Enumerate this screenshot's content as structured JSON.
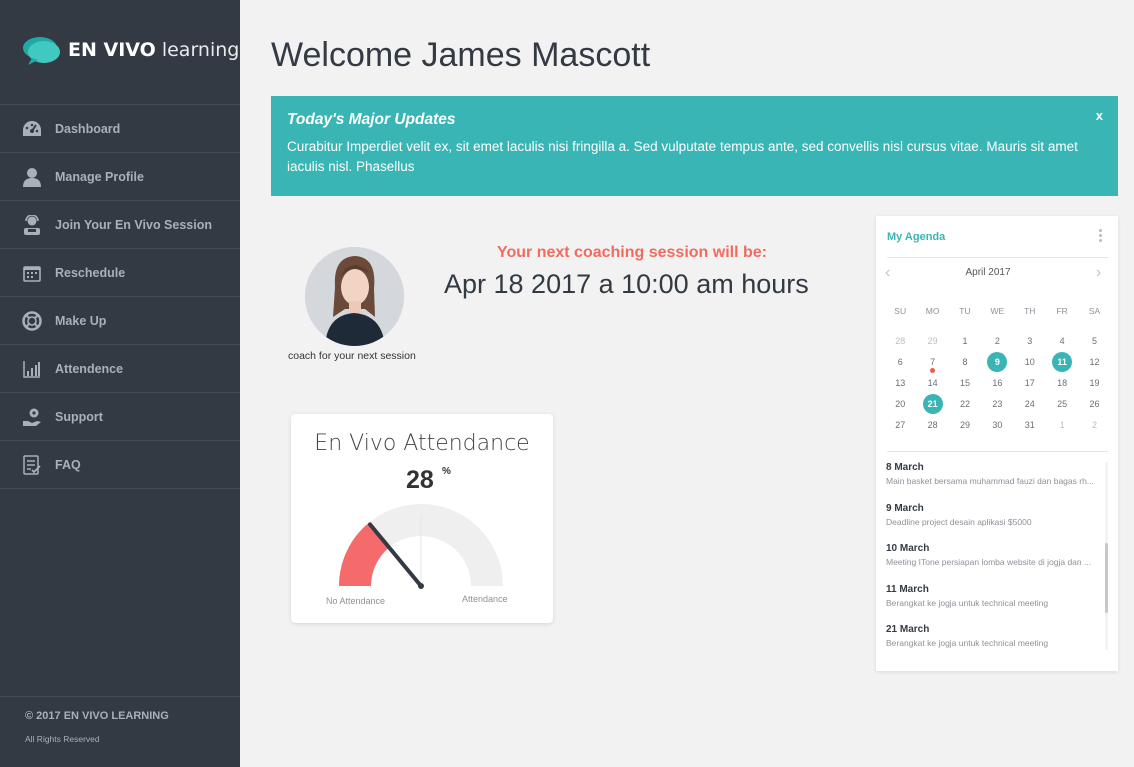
{
  "brand": {
    "name_bold": "EN VIVO",
    "name_light": "learning"
  },
  "sidebar": {
    "items": [
      {
        "label": "Dashboard",
        "icon": "dashboard-icon"
      },
      {
        "label": "Manage Profile",
        "icon": "user-icon"
      },
      {
        "label": "Join Your En Vivo Session",
        "icon": "headset-user-icon"
      },
      {
        "label": "Reschedule",
        "icon": "calendar-icon"
      },
      {
        "label": "Make Up",
        "icon": "lifebuoy-icon"
      },
      {
        "label": "Attendence",
        "icon": "bar-chart-icon"
      },
      {
        "label": "Support",
        "icon": "support-hand-icon"
      },
      {
        "label": "FAQ",
        "icon": "checklist-icon"
      }
    ],
    "copyright": "© 2017 EN VIVO LEARNING",
    "rights": "All Rights Reserved"
  },
  "welcome": "Welcome James Mascott",
  "updates": {
    "title": "Today's Major Updates",
    "body": "Curabitur Imperdiet velit ex, sit emet laculis nisi fringilla a. Sed vulputate tempus ante, sed convellis nisl cursus vitae. Mauris sit amet iaculis nisl. Phasellus",
    "close": "x"
  },
  "coach": {
    "caption": "coach for your next session"
  },
  "next_session": {
    "title": "Your next coaching session will be:",
    "date": "Apr 18 2017 a 10:00 am hours"
  },
  "attendance": {
    "title": "En Vivo Attendance",
    "value": "28",
    "unit": "%",
    "percent": 28,
    "label_left": "No Attendance",
    "label_right": "Attendance",
    "colors": {
      "fill": "#f56a6a",
      "track": "#efefef",
      "needle": "#333a43"
    }
  },
  "agenda": {
    "title": "My Agenda",
    "month": "April 2017",
    "weekdays": [
      "SU",
      "MO",
      "TU",
      "WE",
      "TH",
      "FR",
      "SA"
    ],
    "weeks": [
      [
        {
          "d": "28",
          "m": true
        },
        {
          "d": "29",
          "m": true
        },
        {
          "d": "1"
        },
        {
          "d": "2"
        },
        {
          "d": "3"
        },
        {
          "d": "4"
        },
        {
          "d": "5"
        }
      ],
      [
        {
          "d": "6"
        },
        {
          "d": "7",
          "dot": true
        },
        {
          "d": "8"
        },
        {
          "d": "9",
          "sel": true
        },
        {
          "d": "10"
        },
        {
          "d": "11",
          "sel": true
        },
        {
          "d": "12"
        }
      ],
      [
        {
          "d": "13"
        },
        {
          "d": "14"
        },
        {
          "d": "15"
        },
        {
          "d": "16"
        },
        {
          "d": "17"
        },
        {
          "d": "18"
        },
        {
          "d": "19"
        }
      ],
      [
        {
          "d": "20"
        },
        {
          "d": "21",
          "sel": true
        },
        {
          "d": "22"
        },
        {
          "d": "23"
        },
        {
          "d": "24"
        },
        {
          "d": "25"
        },
        {
          "d": "26"
        }
      ],
      [
        {
          "d": "27"
        },
        {
          "d": "28"
        },
        {
          "d": "29"
        },
        {
          "d": "30"
        },
        {
          "d": "31"
        },
        {
          "d": "1",
          "m": true
        },
        {
          "d": "2",
          "m": true
        }
      ]
    ],
    "events": [
      {
        "date": "8 March",
        "text": "Main basket bersama muhammad fauzi dan bagas rh..."
      },
      {
        "date": "9 March",
        "text": "Deadline project desain aplikasi $5000"
      },
      {
        "date": "10 March",
        "text": "Meeting ITone persiapan lomba website di jogja dan ..."
      },
      {
        "date": "11 March",
        "text": "Berangkat ke jogja untuk technical meeting"
      },
      {
        "date": "21 March",
        "text": "Berangkat ke jogja untuk technical meeting"
      }
    ]
  },
  "colors": {
    "sidebar": "#333a43",
    "accent": "#3ab5b5",
    "highlight": "#f26b5f"
  }
}
